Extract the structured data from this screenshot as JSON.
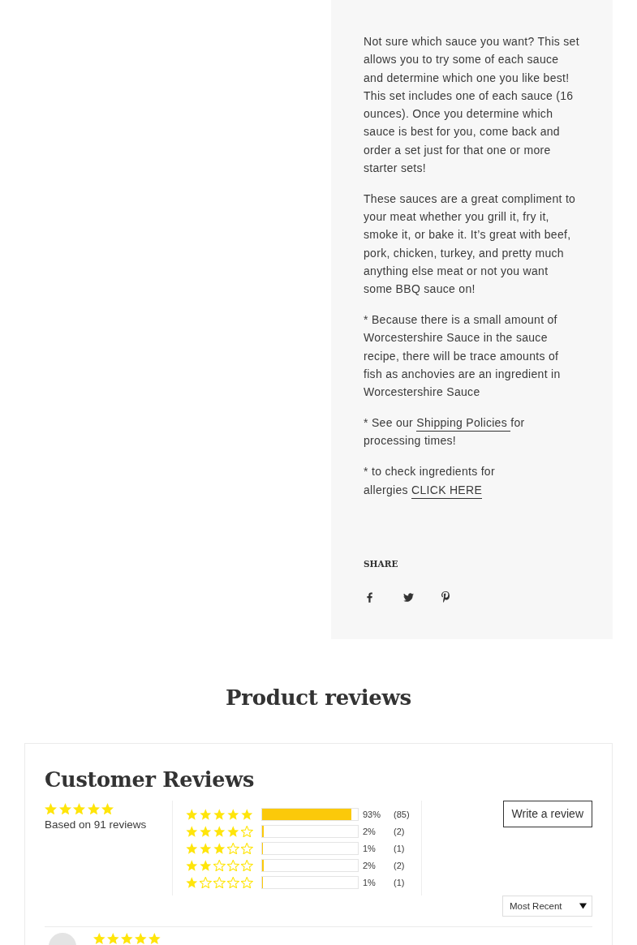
{
  "description": {
    "paragraphs": [
      {
        "parts": [
          {
            "kind": "text",
            "text": "Not sure which sauce you want? This set allows you to try some of each sauce and determine which one you like best! This set includes one of each sauce (16 ounces). Once you determine which sauce is best for you, come back and order a set just for that one or more starter sets!"
          }
        ]
      },
      {
        "parts": [
          {
            "kind": "text",
            "text": "These sauces are a great compliment to your meat whether you grill it, fry it, smoke it, or bake it. It’s great with beef, pork, chicken, turkey, and pretty much anything else meat or not you want some BBQ sauce on!"
          }
        ]
      },
      {
        "parts": [
          {
            "kind": "text",
            "text": "* Because there is a small amount of Worcestershire Sauce in the sauce recipe, there will be trace amounts of fish as anchovies are an ingredient in Worcestershire Sauce"
          }
        ]
      },
      {
        "parts": [
          {
            "kind": "text",
            "text": "* See our "
          },
          {
            "kind": "link",
            "text": "Shipping Policies "
          },
          {
            "kind": "text",
            "text": "for processing times!"
          }
        ]
      },
      {
        "parts": [
          {
            "kind": "text",
            "text": "* to check ingredients for\nallergies "
          },
          {
            "kind": "link",
            "text": "CLICK HERE"
          }
        ]
      }
    ]
  },
  "share": {
    "label": "SHARE"
  },
  "reviews": {
    "heading": "Product reviews",
    "title": "Customer Reviews",
    "average": {
      "stars": 5,
      "summary": "Based on 91 reviews"
    },
    "histogram": [
      {
        "stars": 5,
        "level": 0.93,
        "percent": "93%",
        "count": "(85)"
      },
      {
        "stars": 4,
        "level": 0.02,
        "percent": "2%",
        "count": "(2)"
      },
      {
        "stars": 3,
        "level": 0.01,
        "percent": "1%",
        "count": "(1)"
      },
      {
        "stars": 2,
        "level": 0.02,
        "percent": "2%",
        "count": "(2)"
      },
      {
        "stars": 1,
        "level": 0.01,
        "percent": "1%",
        "count": "(1)"
      }
    ],
    "write_button": "Write a review",
    "sort": {
      "value": "Most Recent"
    },
    "items": [
      {
        "stars": 5
      }
    ]
  }
}
